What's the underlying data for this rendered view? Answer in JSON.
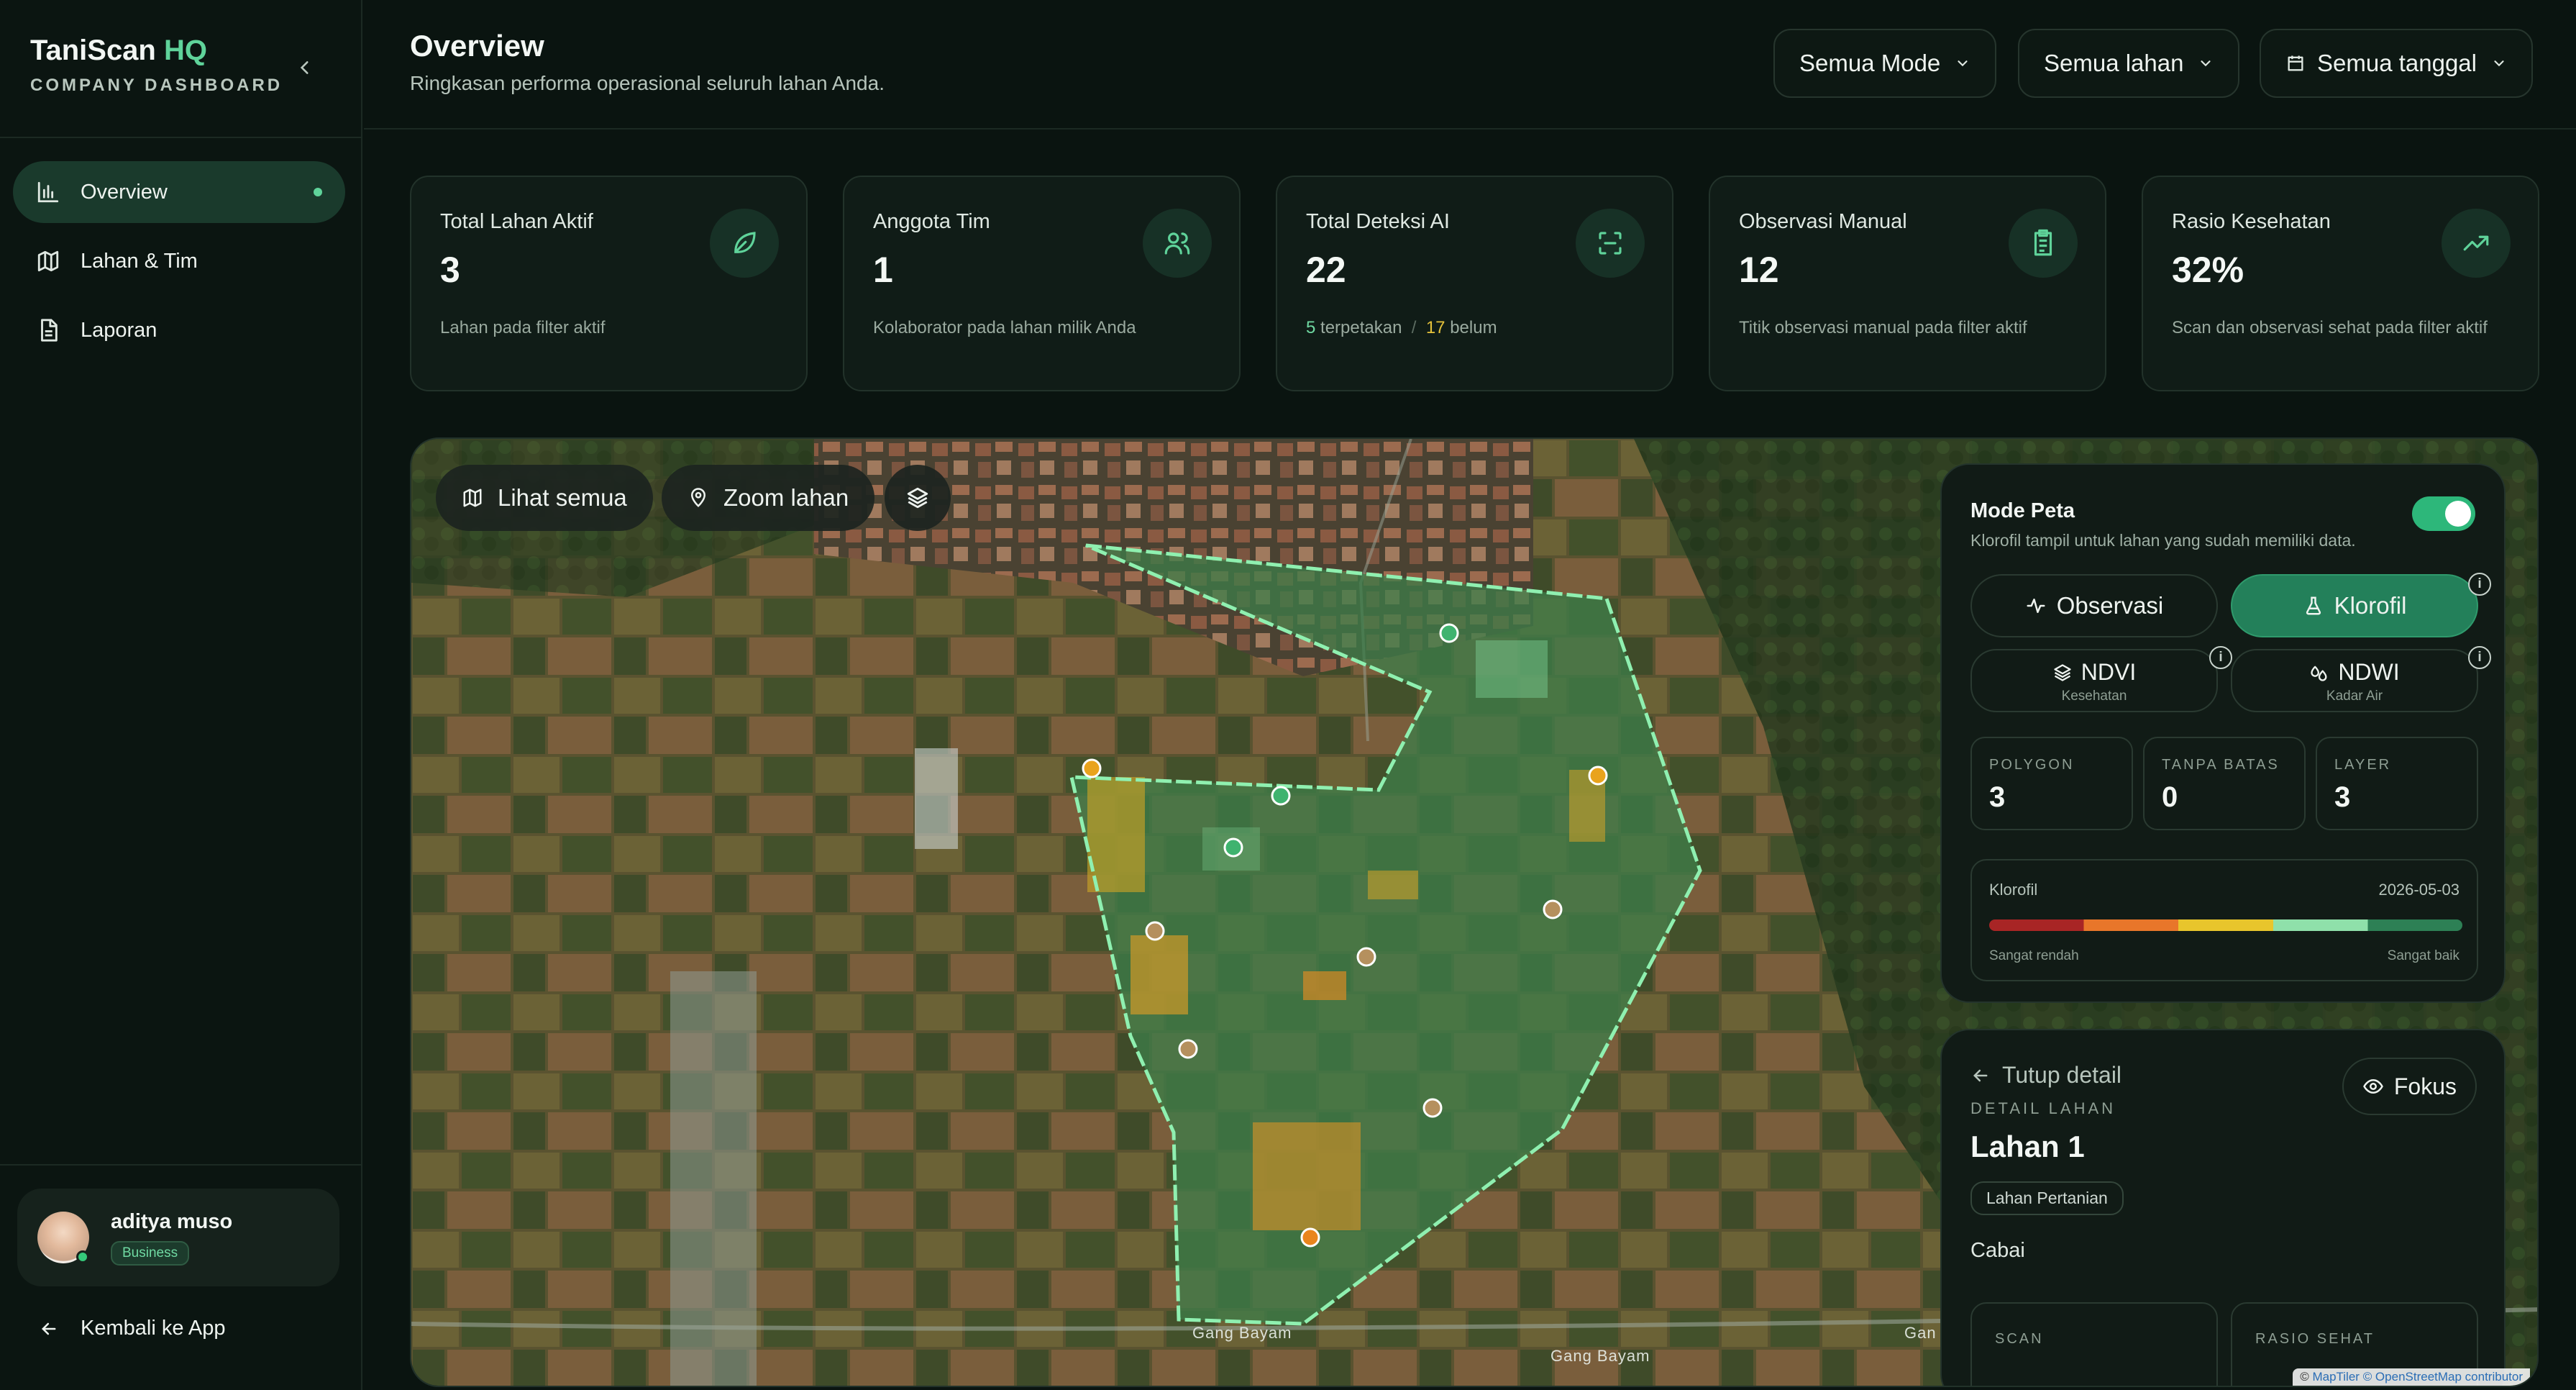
{
  "sidebar": {
    "brand": {
      "name": "TaniScan",
      "name_accent": "HQ",
      "subtitle": "COMPANY DASHBOARD"
    },
    "items": [
      {
        "label": "Overview",
        "icon": "bar-chart-icon",
        "active": true
      },
      {
        "label": "Lahan & Tim",
        "icon": "map-icon",
        "active": false
      },
      {
        "label": "Laporan",
        "icon": "document-icon",
        "active": false
      }
    ],
    "user": {
      "name": "aditya muso",
      "plan": "Business"
    },
    "back_label": "Kembali ke App"
  },
  "header": {
    "title": "Overview",
    "subtitle": "Ringkasan performa operasional seluruh lahan Anda.",
    "filters": {
      "mode": "Semua Mode",
      "lahan": "Semua lahan",
      "tanggal": "Semua tanggal"
    }
  },
  "cards": [
    {
      "title": "Total Lahan Aktif",
      "value": "3",
      "desc": "Lahan pada filter aktif",
      "icon": "leaf-icon"
    },
    {
      "title": "Anggota Tim",
      "value": "1",
      "desc": "Kolaborator pada lahan milik Anda",
      "icon": "users-icon"
    },
    {
      "title": "Total Deteksi AI",
      "value": "22",
      "desc_a_num": "5",
      "desc_a_text": "terpetakan",
      "desc_sep": "/",
      "desc_b_num": "17",
      "desc_b_text": "belum",
      "icon": "scan-icon"
    },
    {
      "title": "Observasi Manual",
      "value": "12",
      "desc": "Titik observasi manual pada filter aktif",
      "icon": "clipboard-icon"
    },
    {
      "title": "Rasio Kesehatan",
      "value": "32%",
      "desc": "Scan dan observasi sehat pada filter aktif",
      "icon": "trending-up-icon"
    }
  ],
  "map": {
    "buttons": {
      "lihat_semua": "Lihat semua",
      "zoom_lahan": "Zoom lahan"
    },
    "roads": [
      "Gang Bayam",
      "Gang Bayam",
      "Gan"
    ],
    "attribution": {
      "prefix": "©",
      "maptiler": "MapTiler",
      "osm": "© OpenStreetMap contributor"
    }
  },
  "panel": {
    "title": "Mode Peta",
    "subtitle": "Klorofil tampil untuk lahan yang sudah memiliki data.",
    "toggle_on": true,
    "modes": {
      "observasi": "Observasi",
      "klorofil": "Klorofil",
      "ndvi": "NDVI",
      "ndvi_sub": "Kesehatan",
      "ndwi": "NDWI",
      "ndwi_sub": "Kadar Air"
    },
    "stats": [
      {
        "label": "POLYGON",
        "value": "3"
      },
      {
        "label": "TANPA BATAS",
        "value": "0"
      },
      {
        "label": "LAYER",
        "value": "3"
      }
    ],
    "legend": {
      "label": "Klorofil",
      "date": "2026-05-03",
      "low": "Sangat rendah",
      "high": "Sangat baik"
    }
  },
  "detail": {
    "back": "Tutup detail",
    "caption": "DETAIL LAHAN",
    "name": "Lahan 1",
    "tag": "Lahan Pertanian",
    "crop": "Cabai",
    "focus": "Fokus",
    "stats": [
      {
        "label": "SCAN"
      },
      {
        "label": "RASIO SEHAT"
      }
    ]
  }
}
